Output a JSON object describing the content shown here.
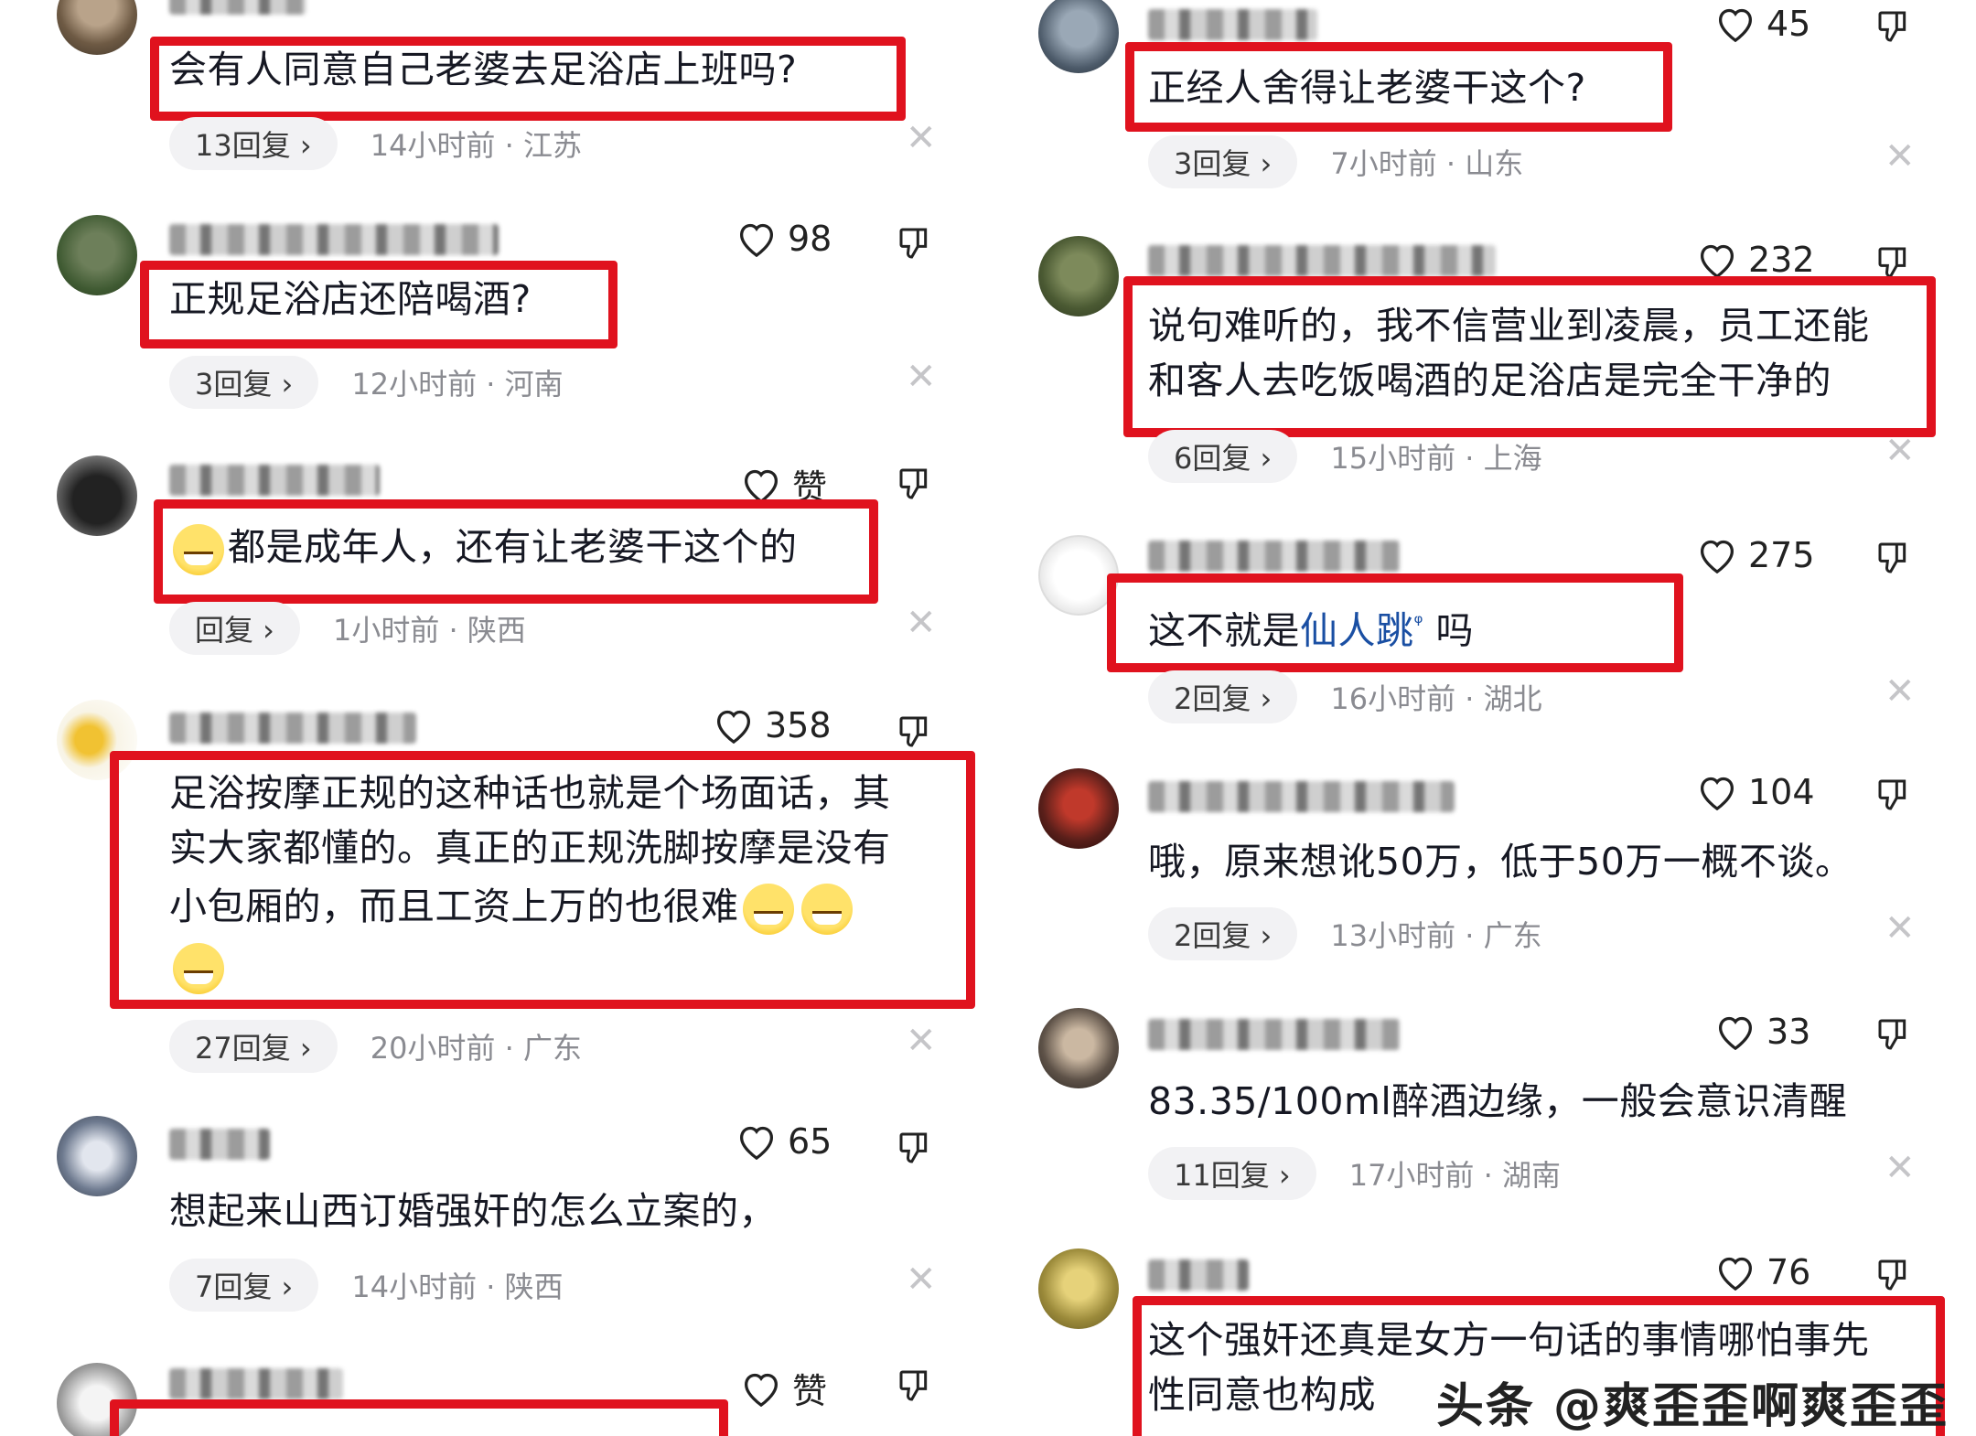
{
  "left_column": [
    {
      "text": "会有人同意自己老婆去足浴店上班吗?",
      "replies": "13回复 ›",
      "meta": "14小时前 · 江苏",
      "likes": ""
    },
    {
      "text": "正规足浴店还陪喝酒?",
      "replies": "3回复 ›",
      "meta": "12小时前 · 河南",
      "likes": "98"
    },
    {
      "text": "都是成年人，还有让老婆干这个的",
      "replies": "回复 ›",
      "meta": "1小时前 · 陕西",
      "likes": "赞"
    },
    {
      "text_lines": [
        "足浴按摩正规的这种话也就是个场面话，其",
        "实大家都懂的。真正的正规洗脚按摩是没有",
        "小包厢的，而且工资上万的也很难"
      ],
      "replies": "27回复 ›",
      "meta": "20小时前 · 广东",
      "likes": "358"
    },
    {
      "text": "想起来山西订婚强奸的怎么立案的，",
      "replies": "7回复 ›",
      "meta": "14小时前 · 陕西",
      "likes": "65"
    },
    {
      "text": "",
      "replies": "",
      "meta": "",
      "likes": "赞"
    }
  ],
  "right_column": [
    {
      "text": "正经人舍得让老婆干这个?",
      "replies": "3回复 ›",
      "meta": "7小时前 · 山东",
      "likes": "45"
    },
    {
      "text_lines": [
        "说句难听的，我不信营业到凌晨，员工还能",
        "和客人去吃饭喝酒的足浴店是完全干净的"
      ],
      "replies": "6回复 ›",
      "meta": "15小时前 · 上海",
      "likes": "232"
    },
    {
      "text_before": "这不就是",
      "text_link": "仙人跳",
      "text_after": " 吗",
      "replies": "2回复 ›",
      "meta": "16小时前 · 湖北",
      "likes": "275"
    },
    {
      "text": "哦，原来想讹50万，低于50万一概不谈。",
      "replies": "2回复 ›",
      "meta": "13小时前 · 广东",
      "likes": "104"
    },
    {
      "text": "83.35/100ml醉酒边缘，一般会意识清醒",
      "replies": "11回复 ›",
      "meta": "17小时前 · 湖南",
      "likes": "33"
    },
    {
      "text_lines": [
        "这个强奸还真是女方一句话的事情哪怕事先",
        "性同意也构成"
      ],
      "replies": "",
      "meta": "",
      "likes": "76"
    }
  ],
  "watermark": "头条 @爽歪歪啊爽歪歪",
  "colors": {
    "highlight_box": "#e0121e",
    "link": "#1a4fa3",
    "meta": "#8a8b91"
  }
}
